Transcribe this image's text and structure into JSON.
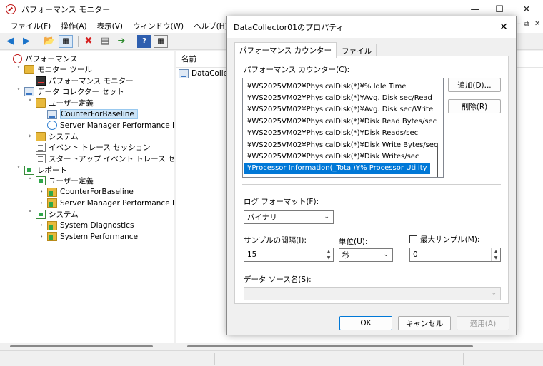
{
  "main_window": {
    "title": "パフォーマンス モニター",
    "controls": {
      "minimize": "—",
      "maximize": "☐",
      "close": "✕"
    }
  },
  "menubar": {
    "items": [
      "ファイル(F)",
      "操作(A)",
      "表示(V)",
      "ウィンドウ(W)",
      "ヘルプ(H)"
    ],
    "mdi_controls": [
      "–",
      "⧉",
      "✕"
    ]
  },
  "toolbar": {
    "icons": [
      "back-icon",
      "forward-icon",
      "up-folder-icon",
      "show-hide-tree-icon",
      "delete-icon",
      "properties-icon",
      "export-icon",
      "help-icon",
      "view-icon"
    ]
  },
  "tree": {
    "items": [
      {
        "label": "パフォーマンス",
        "icon": "perf-icon",
        "expander": "",
        "indent": 0
      },
      {
        "label": "モニター ツール",
        "icon": "folder-icon",
        "expander": "˅",
        "indent": 1
      },
      {
        "label": "パフォーマンス モニター",
        "icon": "monitor-icon",
        "expander": "",
        "indent": 2
      },
      {
        "label": "データ コレクター セット",
        "icon": "collector-set-icon",
        "expander": "˅",
        "indent": 1
      },
      {
        "label": "ユーザー定義",
        "icon": "folder-icon",
        "expander": "˅",
        "indent": 2
      },
      {
        "label": "CounterForBaseline",
        "icon": "collector-icon",
        "expander": "",
        "indent": 3,
        "selected": true
      },
      {
        "label": "Server Manager Performance Monito",
        "icon": "clock-icon",
        "expander": "",
        "indent": 3
      },
      {
        "label": "システム",
        "icon": "folder-icon",
        "expander": "›",
        "indent": 2
      },
      {
        "label": "イベント トレース セッション",
        "icon": "trace-icon",
        "expander": "",
        "indent": 2
      },
      {
        "label": "スタートアップ イベント トレース セッション",
        "icon": "trace-icon",
        "expander": "",
        "indent": 2
      },
      {
        "label": "レポート",
        "icon": "report-icon",
        "expander": "˅",
        "indent": 1
      },
      {
        "label": "ユーザー定義",
        "icon": "report-icon",
        "expander": "˅",
        "indent": 2
      },
      {
        "label": "CounterForBaseline",
        "icon": "folder-green-icon",
        "expander": "›",
        "indent": 3
      },
      {
        "label": "Server Manager Performance Monito",
        "icon": "folder-green-icon",
        "expander": "›",
        "indent": 3
      },
      {
        "label": "システム",
        "icon": "report-icon",
        "expander": "˅",
        "indent": 2
      },
      {
        "label": "System Diagnostics",
        "icon": "folder-green-icon",
        "expander": "›",
        "indent": 3
      },
      {
        "label": "System Performance",
        "icon": "folder-green-icon",
        "expander": "›",
        "indent": 3
      }
    ]
  },
  "list_pane": {
    "column_name": "名前",
    "rows": [
      "DataCollect"
    ]
  },
  "dialog": {
    "title": "DataCollector01のプロパティ",
    "close": "✕",
    "tabs": [
      "パフォーマンス カウンター",
      "ファイル"
    ],
    "active_tab": 0,
    "counters_label": "パフォーマンス カウンター(C):",
    "counters": [
      "¥WS2025VM02¥PhysicalDisk(*)¥% Idle Time",
      "¥WS2025VM02¥PhysicalDisk(*)¥Avg. Disk sec/Read",
      "¥WS2025VM02¥PhysicalDisk(*)¥Avg. Disk sec/Write",
      "¥WS2025VM02¥PhysicalDisk(*)¥Disk Read Bytes/sec",
      "¥WS2025VM02¥PhysicalDisk(*)¥Disk Reads/sec",
      "¥WS2025VM02¥PhysicalDisk(*)¥Disk Write Bytes/sec",
      "¥WS2025VM02¥PhysicalDisk(*)¥Disk Writes/sec",
      "¥Processor Information(_Total)¥% Processor Utility"
    ],
    "selected_counter": 7,
    "add_button": "追加(D)...",
    "remove_button": "削除(R)",
    "log_format_label": "ログ フォーマット(F):",
    "log_format_value": "バイナリ",
    "interval_label": "サンプルの間隔(I):",
    "interval_value": "15",
    "unit_label": "単位(U):",
    "unit_value": "秒",
    "max_samples_label": "最大サンプル(M):",
    "max_samples_value": "0",
    "max_samples_checked": false,
    "data_source_label": "データ ソース名(S):",
    "data_source_value": "",
    "ok_button": "OK",
    "cancel_button": "キャンセル",
    "apply_button": "適用(A)",
    "accent_color": "#0078d7"
  }
}
